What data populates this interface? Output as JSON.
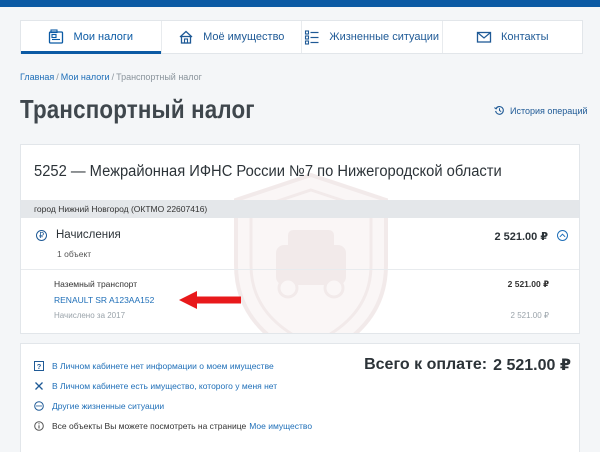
{
  "nav": {
    "items": [
      {
        "label": "Мои налоги",
        "icon": "wallet-icon"
      },
      {
        "label": "Моё имущество",
        "icon": "house-icon"
      },
      {
        "label": "Жизненные ситуации",
        "icon": "checklist-icon"
      },
      {
        "label": "Контакты",
        "icon": "envelope-icon"
      }
    ]
  },
  "breadcrumb": {
    "home": "Главная",
    "my_taxes": "Мои налоги",
    "current": "Транспортный налог"
  },
  "page": {
    "title": "Транспортный налог",
    "history_link": "История операций"
  },
  "card": {
    "org_title": "5252 — Межрайонная ИФНС России №7 по Нижегородской области",
    "city": "город Нижний Новгород (ОКТМО 22607416)",
    "charges": {
      "p_icon": "₽",
      "label": "Начисления",
      "count": "1 объект",
      "total": "2 521.00 ₽"
    },
    "item": {
      "type_label": "Наземный транспорт",
      "amount": "2 521.00 ₽",
      "car": "RENAULT SR A123AA152",
      "accrued_label": "Начислено за 2017",
      "accrued_amount": "2 521.00 ₽"
    }
  },
  "bottom": {
    "links": [
      {
        "icon": "question-icon",
        "text": "В Личном кабинете нет информации о моем имуществе"
      },
      {
        "icon": "x-icon",
        "text": "В Личном кабинете есть имущество, которого у меня нет"
      },
      {
        "icon": "dots-icon",
        "text": "Другие жизненные ситуации"
      }
    ],
    "note_text": "Все объекты Вы можете посмотреть на странице",
    "note_link": "Мое имущество",
    "total_label": "Всего к оплате:",
    "total_value": "2 521.00 ₽"
  },
  "colors": {
    "brand": "#0b5aa4",
    "link": "#1f6fb8",
    "arrow": "#e8191b"
  }
}
